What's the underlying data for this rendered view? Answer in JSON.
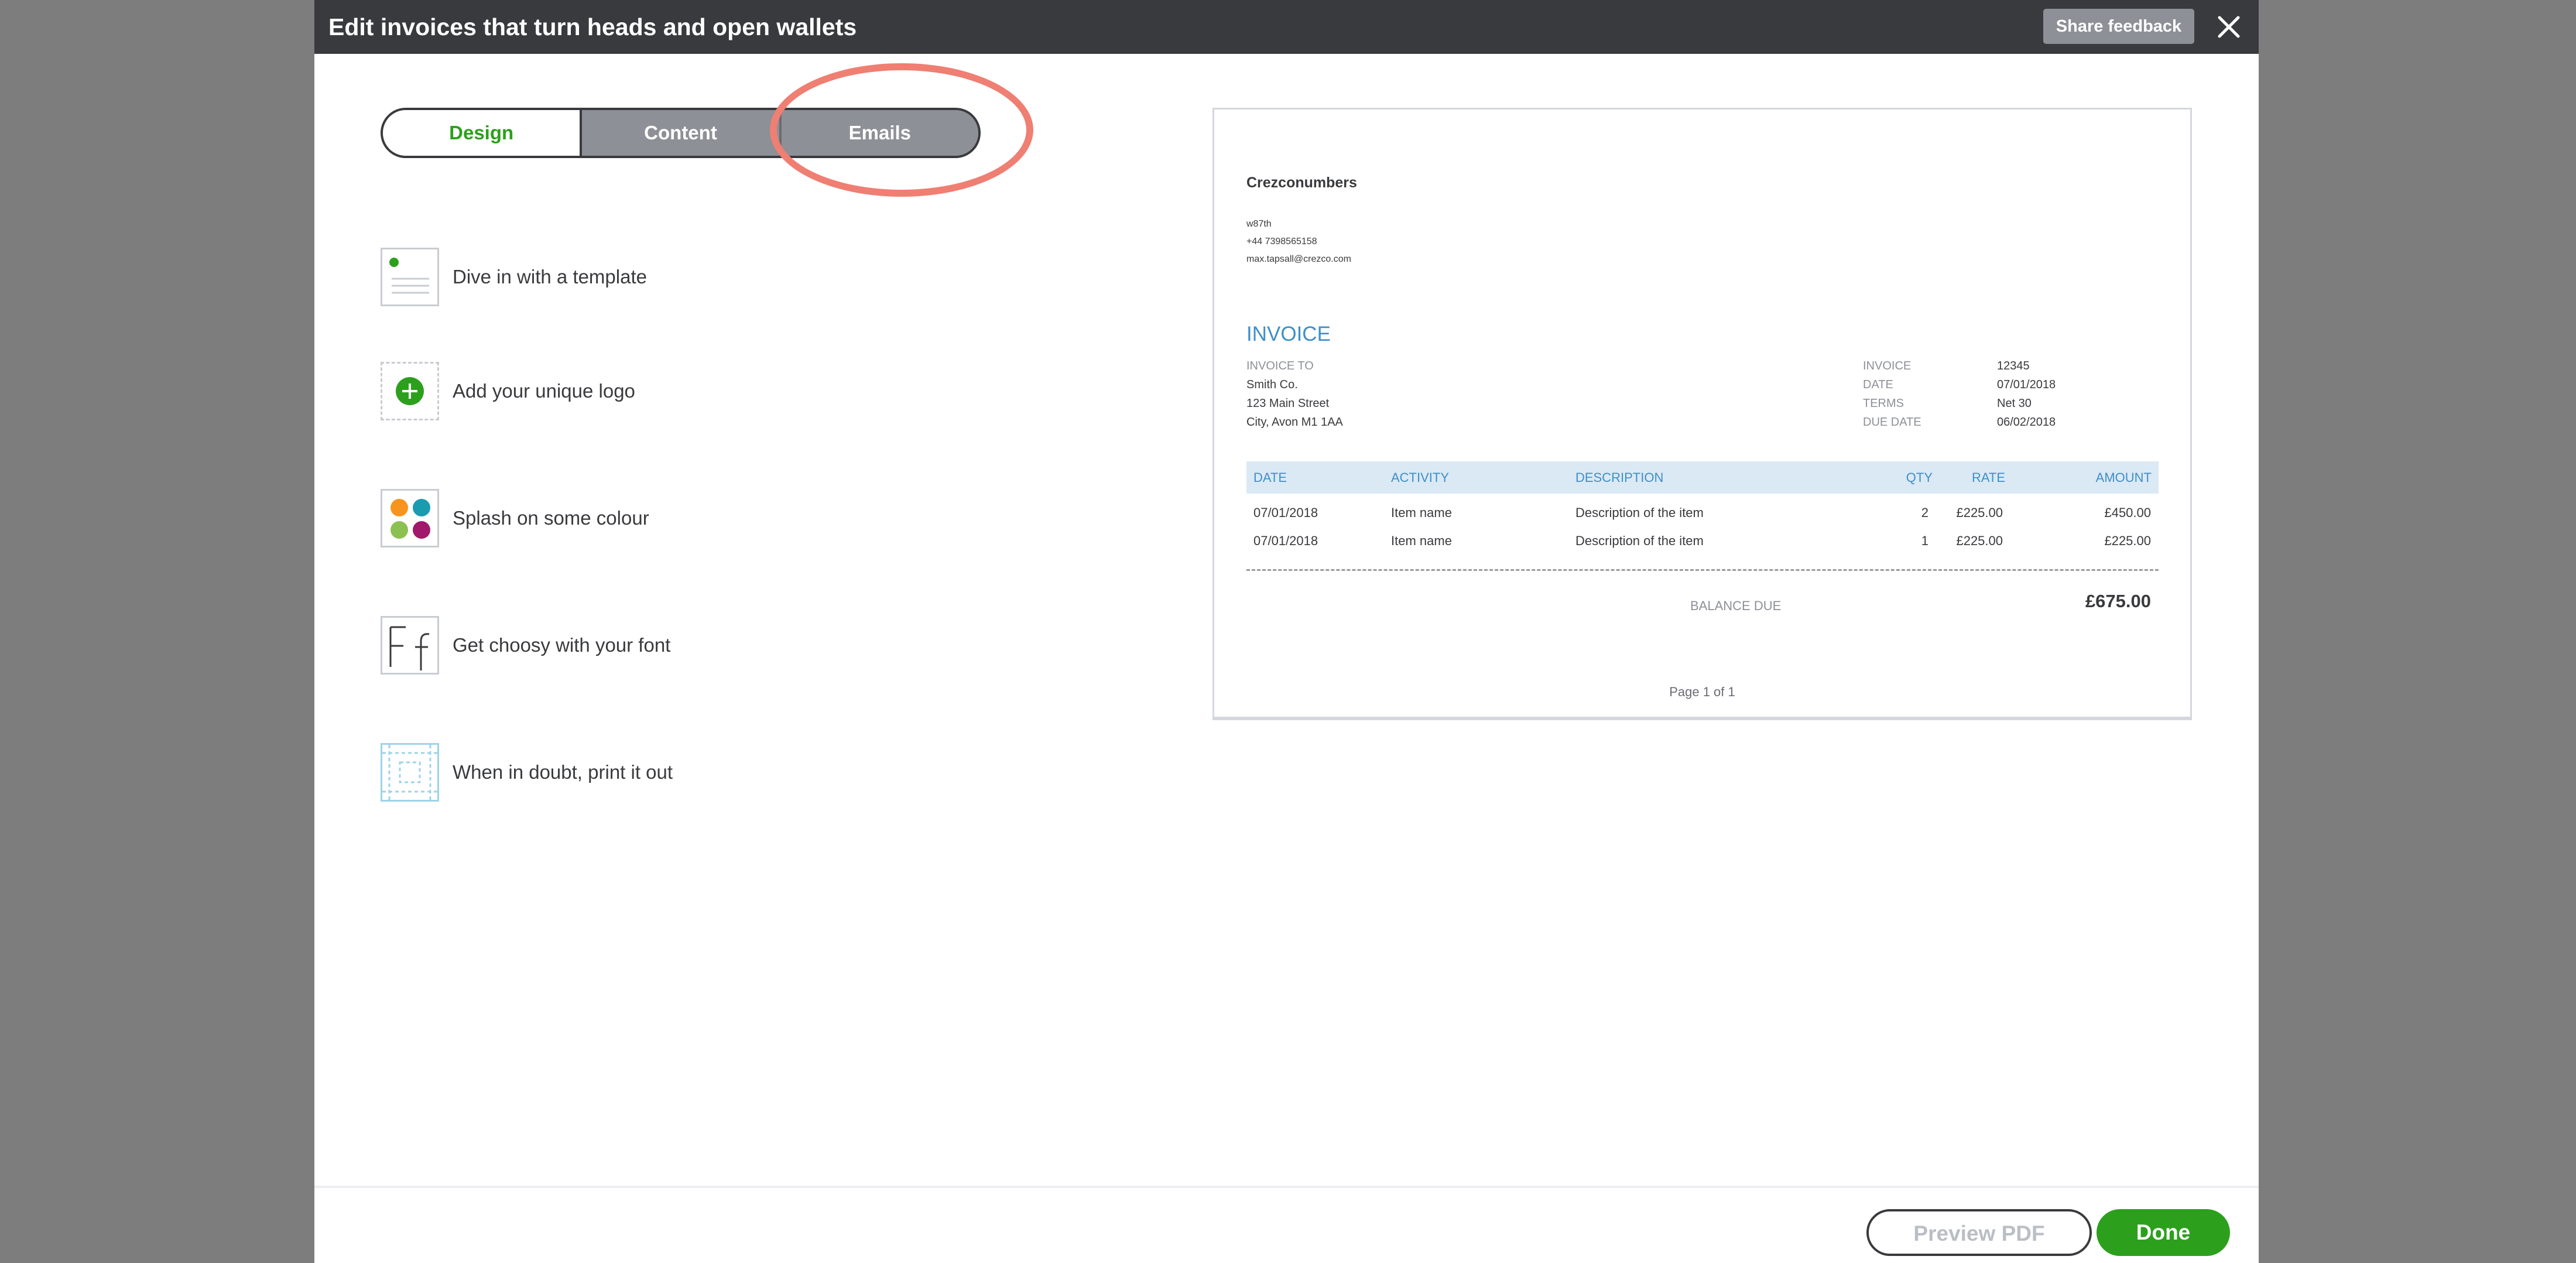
{
  "dialog": {
    "title": "Edit invoices that turn heads and open wallets",
    "share_feedback_label": "Share feedback"
  },
  "tabs": [
    {
      "label": "Design",
      "active": true
    },
    {
      "label": "Content",
      "active": false
    },
    {
      "label": "Emails",
      "active": false
    }
  ],
  "features": [
    {
      "label": "Dive in with a template",
      "icon": "template-icon"
    },
    {
      "label": "Add your unique logo",
      "icon": "add-logo-icon"
    },
    {
      "label": "Splash on some colour",
      "icon": "colour-palette-icon"
    },
    {
      "label": "Get choosy with your font",
      "icon": "font-icon"
    },
    {
      "label": "When in doubt, print it out",
      "icon": "print-layout-icon"
    }
  ],
  "invoice": {
    "company": "Crezconumbers",
    "address_line": "w87th",
    "phone": "+44 7398565158",
    "email": "max.tapsall@crezco.com",
    "heading": "INVOICE",
    "invoice_to_label": "INVOICE TO",
    "customer": [
      "Smith Co.",
      "123 Main Street",
      "City, Avon M1 1AA"
    ],
    "meta": [
      {
        "label": "INVOICE",
        "value": "12345"
      },
      {
        "label": "DATE",
        "value": "07/01/2018"
      },
      {
        "label": "TERMS",
        "value": "Net 30"
      },
      {
        "label": "DUE DATE",
        "value": "06/02/2018"
      }
    ],
    "columns": [
      "DATE",
      "ACTIVITY",
      "DESCRIPTION",
      "QTY",
      "RATE",
      "AMOUNT"
    ],
    "rows": [
      {
        "date": "07/01/2018",
        "activity": "Item name",
        "description": "Description of the item",
        "qty": "2",
        "rate": "£225.00",
        "amount": "£450.00"
      },
      {
        "date": "07/01/2018",
        "activity": "Item name",
        "description": "Description of the item",
        "qty": "1",
        "rate": "£225.00",
        "amount": "£225.00"
      }
    ],
    "balance_due_label": "BALANCE DUE",
    "balance_due_value": "£675.00",
    "page_label": "Page 1 of 1"
  },
  "footer": {
    "preview_pdf_label": "Preview PDF",
    "done_label": "Done"
  },
  "colors": {
    "brand_green": "#2ca01c",
    "header_dark": "#393a3d",
    "invoice_blue": "#3f8fc8",
    "highlight": "#ef7f73"
  }
}
